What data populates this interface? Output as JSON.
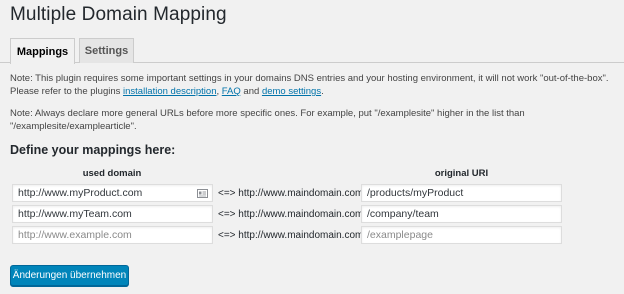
{
  "page": {
    "title": "Multiple Domain Mapping"
  },
  "tabs": [
    {
      "label": "Mappings"
    },
    {
      "label": "Settings"
    }
  ],
  "notes": {
    "note1_prefix": "Note: This plugin requires some important settings in your domains DNS entries and your hosting environment, it will not work \"out-of-the-box\".",
    "note1_line2": "Please refer to the plugins ",
    "link_installation": "installation description",
    "sep1": ", ",
    "link_faq": "FAQ",
    "sep2": " and ",
    "link_demo": "demo settings",
    "end": ".",
    "note2": "Note: Always declare more general URLs before more specific ones. For example, put \"/examplesite\" higher in the list than \"/examplesite/examplearticle\"."
  },
  "mappings": {
    "section_title": "Define your mappings here:",
    "col_used_domain": "used domain",
    "col_original_uri": "original URI",
    "arrow_text": "<=> http://www.maindomain.com",
    "rows": [
      {
        "domain": "http://www.myProduct.com",
        "uri": "/products/myProduct"
      },
      {
        "domain": "http://www.myTeam.com",
        "uri": "/company/team"
      }
    ],
    "placeholder_domain": "http://www.example.com",
    "placeholder_uri": "/examplepage"
  },
  "submit_label": "Änderungen übernehmen",
  "colors": {
    "link": "#0073aa",
    "button": "#0085ba"
  }
}
